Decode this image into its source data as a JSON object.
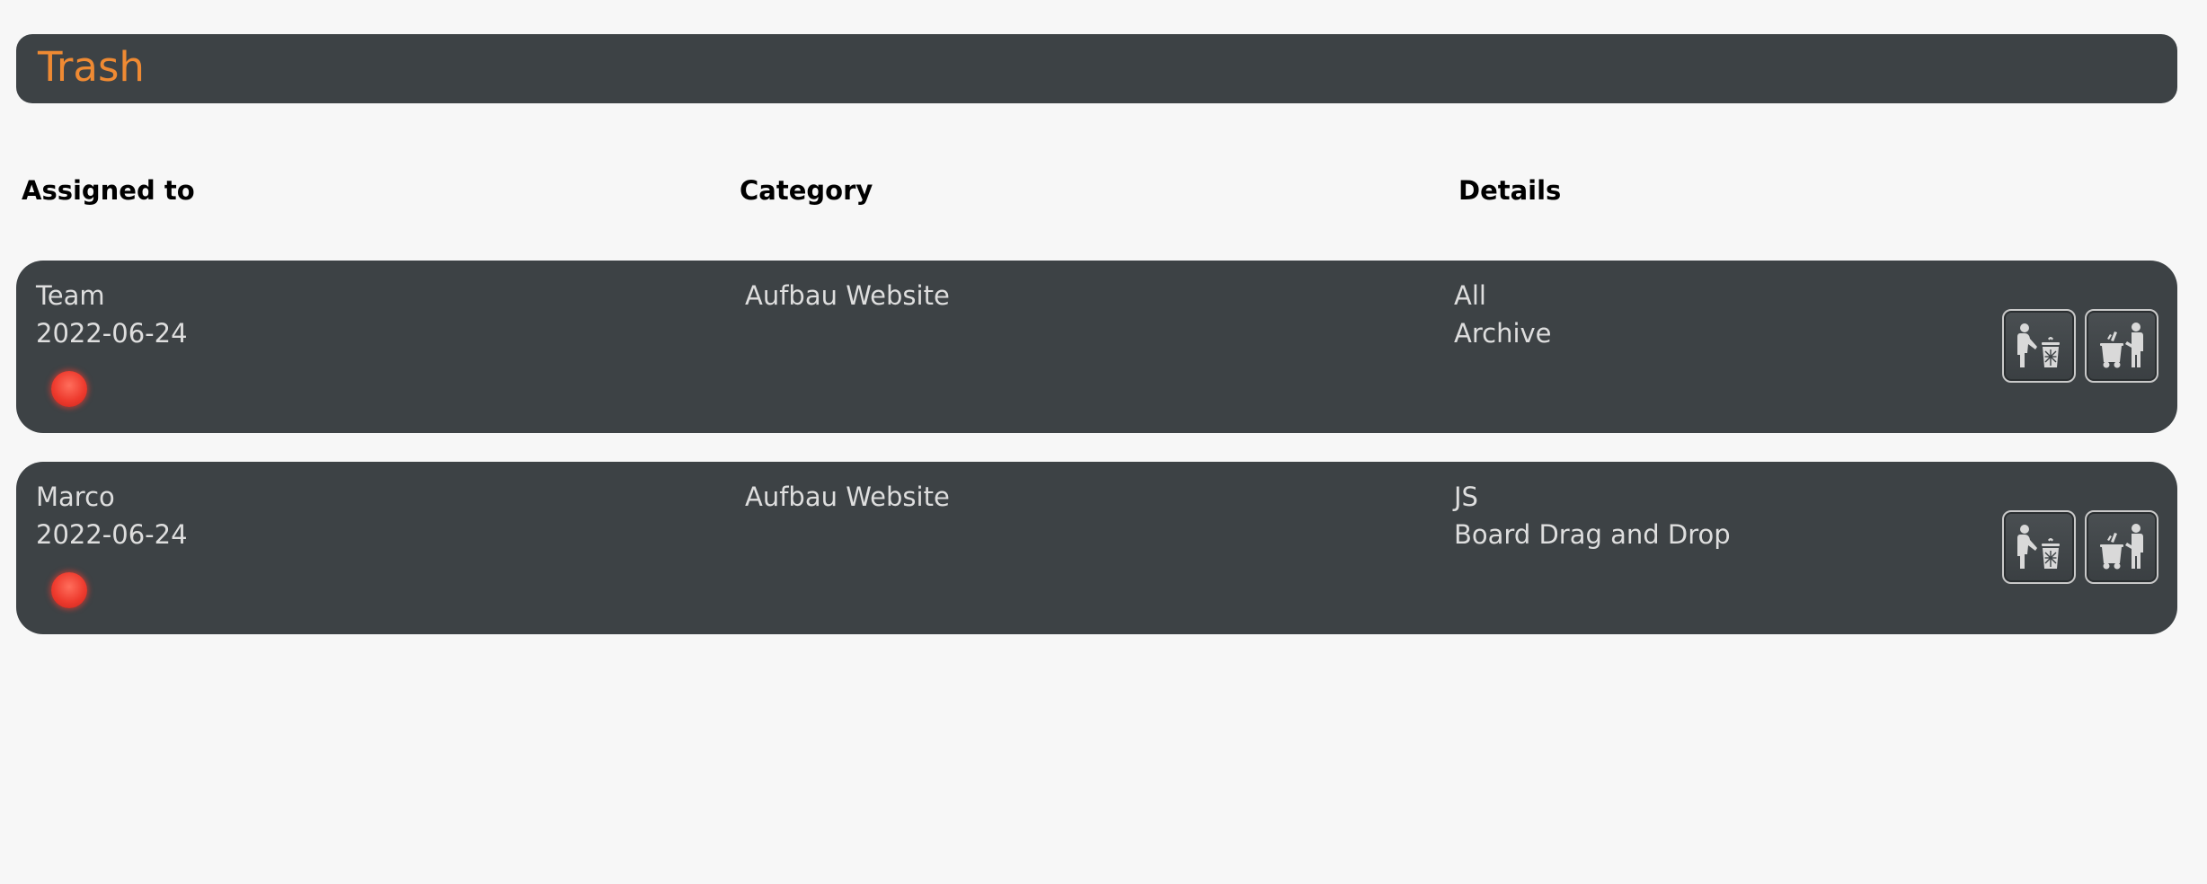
{
  "page": {
    "title": "Trash",
    "title_color": "#ef8a33",
    "panel_color": "#3d4245"
  },
  "table": {
    "headers": {
      "assigned_to": "Assigned to",
      "category": "Category",
      "details": "Details"
    }
  },
  "rows": [
    {
      "assignee": "Team",
      "date": "2022-06-24",
      "category": "Aufbau Website",
      "details_line1": "All",
      "details_line2": "Archive",
      "status_color": "#ee3b2e",
      "actions": [
        "delete-permanently-icon",
        "restore-icon"
      ]
    },
    {
      "assignee": "Marco",
      "date": "2022-06-24",
      "category": "Aufbau Website",
      "details_line1": "JS",
      "details_line2": "Board Drag and Drop",
      "status_color": "#ee3b2e",
      "actions": [
        "delete-permanently-icon",
        "restore-icon"
      ]
    }
  ]
}
